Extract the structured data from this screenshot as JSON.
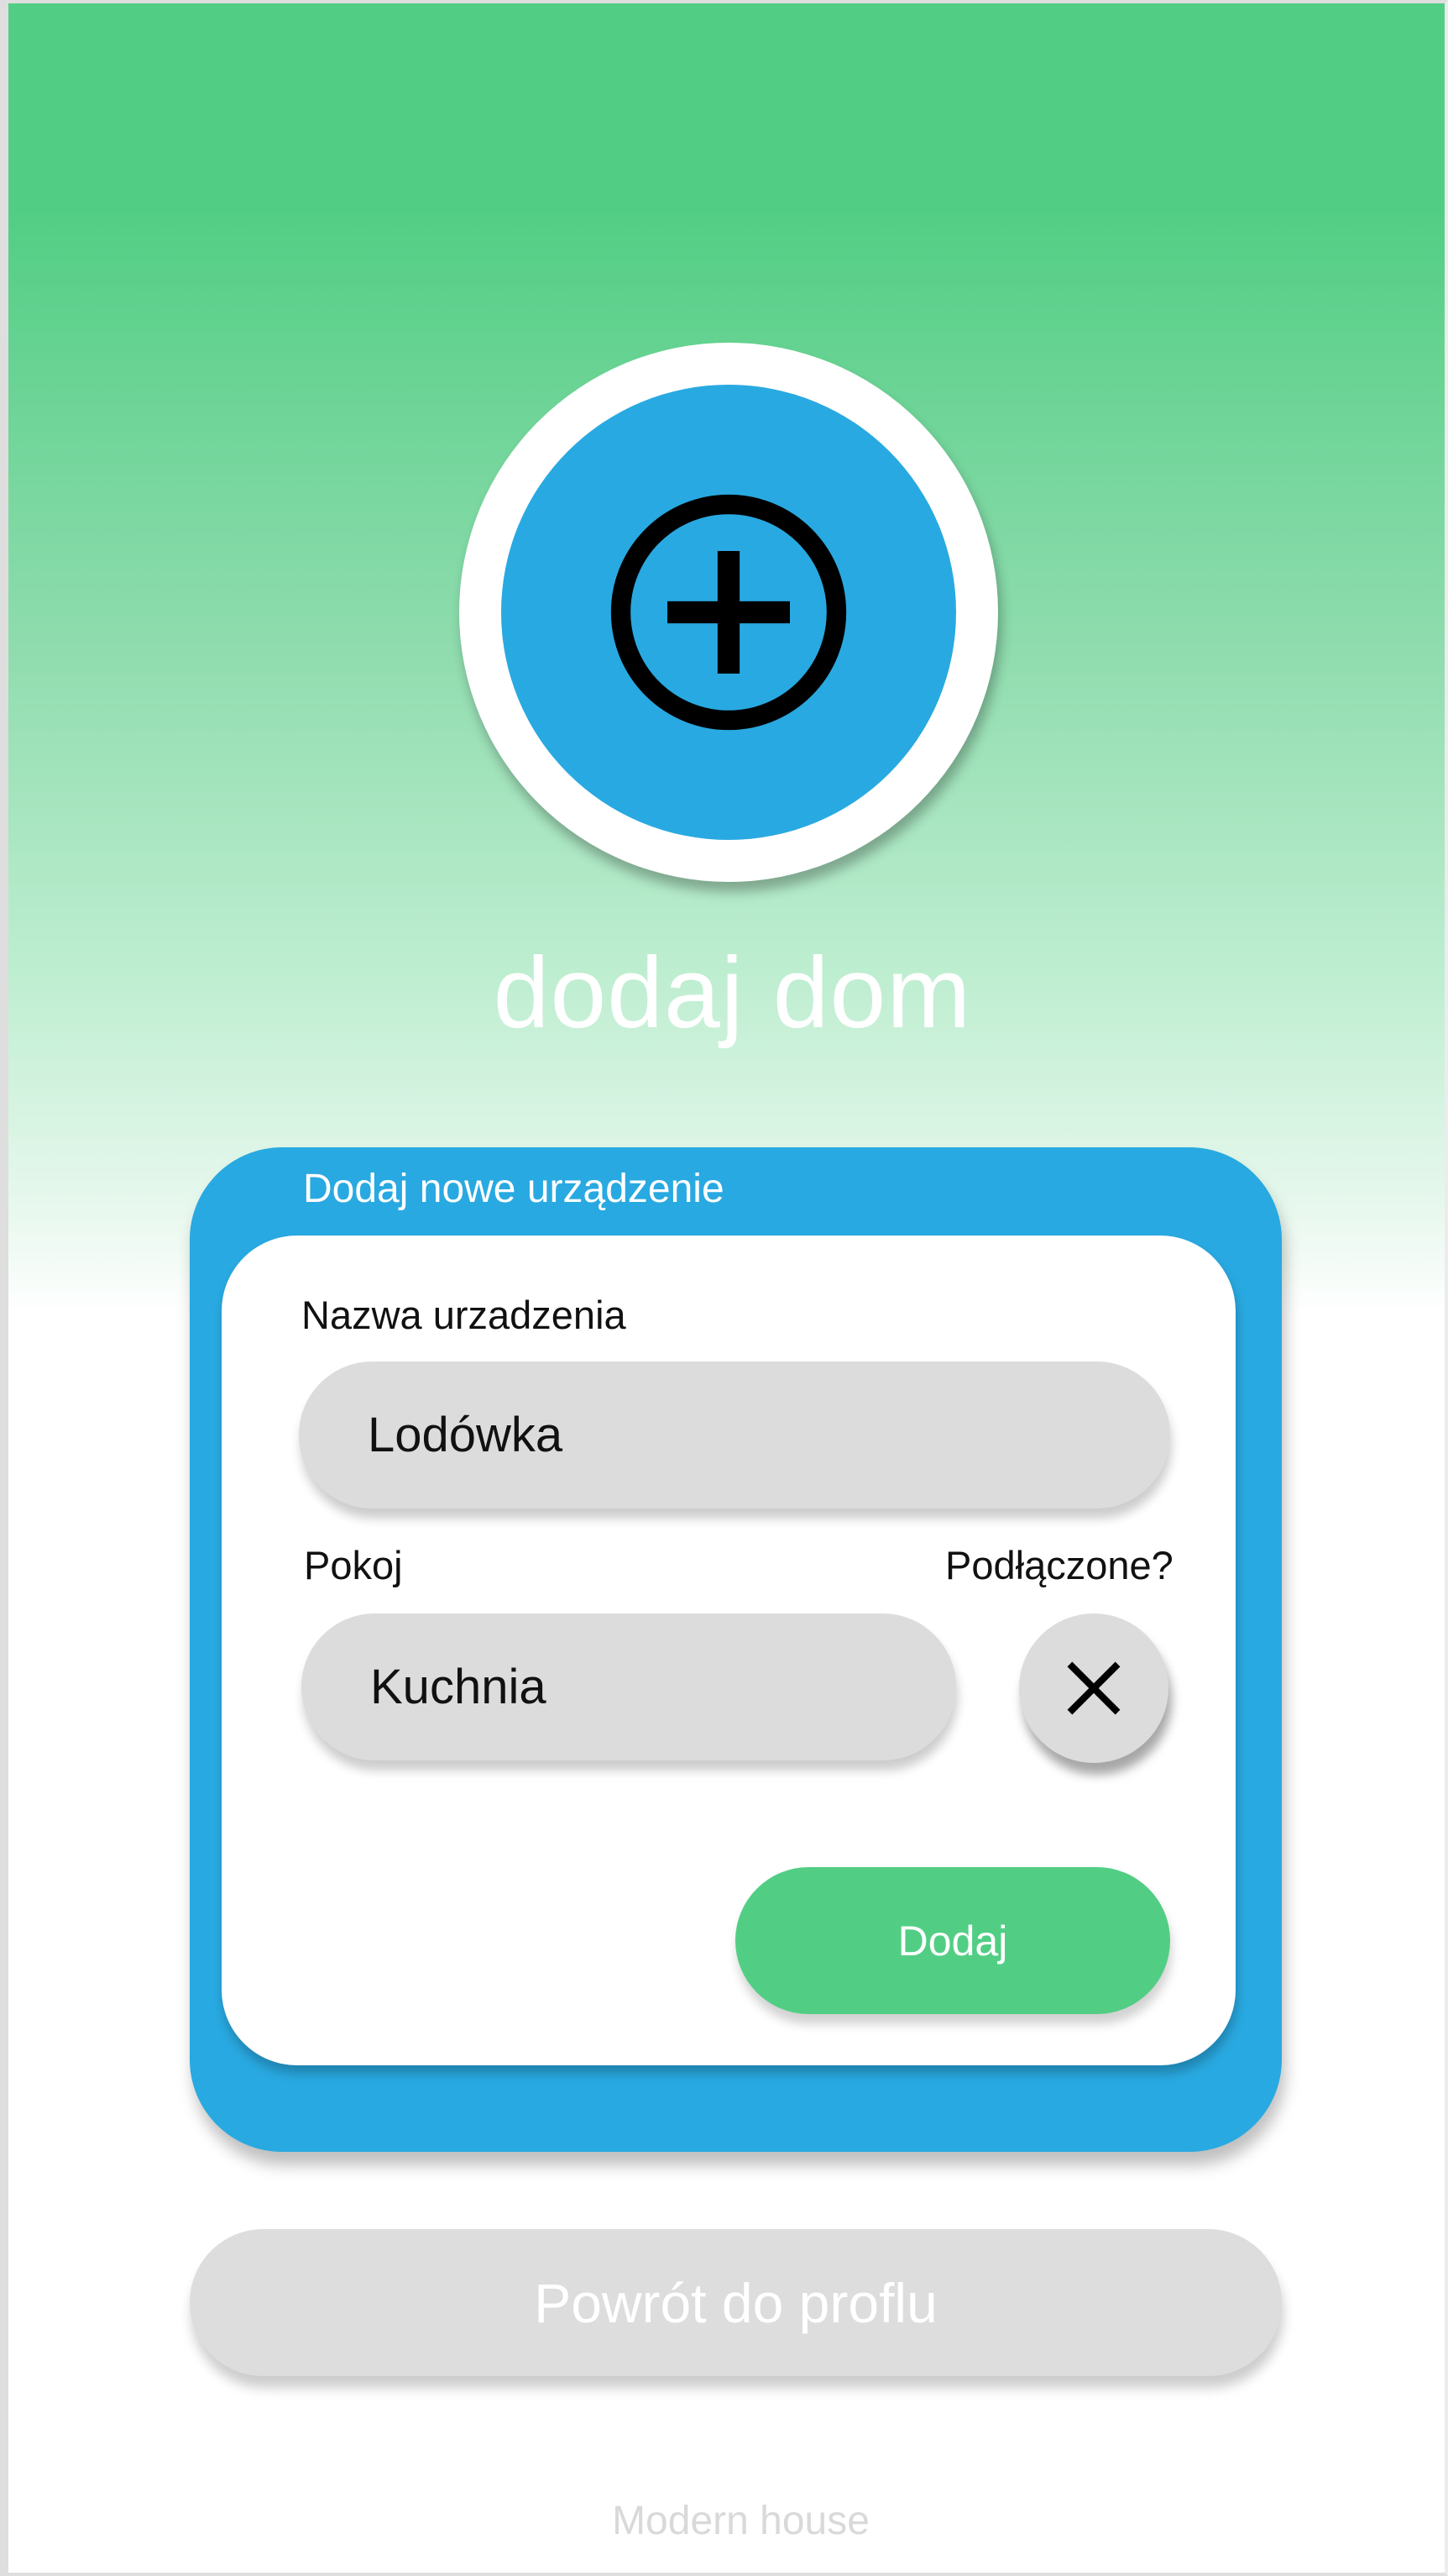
{
  "header": {
    "add_icon": "circle-plus-icon",
    "title": "dodaj dom"
  },
  "form": {
    "title": "Dodaj nowe urządzenie",
    "device_name": {
      "label": "Nazwa urzadzenia",
      "value": "Lodówka"
    },
    "room": {
      "label": "Pokoj",
      "value": "Kuchnia"
    },
    "connected": {
      "label": "Podłączone?",
      "icon": "close-icon",
      "checked": false
    },
    "submit_label": "Dodaj"
  },
  "back_button_label": "Powrót do proflu",
  "footer": "Modern house",
  "colors": {
    "green": "#52ce84",
    "blue": "#29a9e1",
    "input_gray": "#dcdcdc",
    "white": "#ffffff"
  }
}
